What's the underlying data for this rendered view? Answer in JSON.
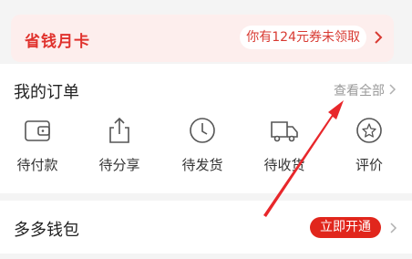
{
  "banner": {
    "title": "省钱月卡",
    "coupon_text": "你有124元券未领取"
  },
  "orders": {
    "title": "我的订单",
    "view_all": "查看全部",
    "items": [
      {
        "label": "待付款",
        "icon": "wallet-icon"
      },
      {
        "label": "待分享",
        "icon": "share-icon"
      },
      {
        "label": "待发货",
        "icon": "clock-icon"
      },
      {
        "label": "待收货",
        "icon": "truck-icon"
      },
      {
        "label": "评价",
        "icon": "review-star-icon"
      }
    ]
  },
  "wallet": {
    "title": "多多钱包",
    "activate_label": "立即开通"
  },
  "colors": {
    "accent": "#e1261c",
    "banner_bg": "#fdeeed",
    "annotation_arrow": "#e8272b"
  }
}
